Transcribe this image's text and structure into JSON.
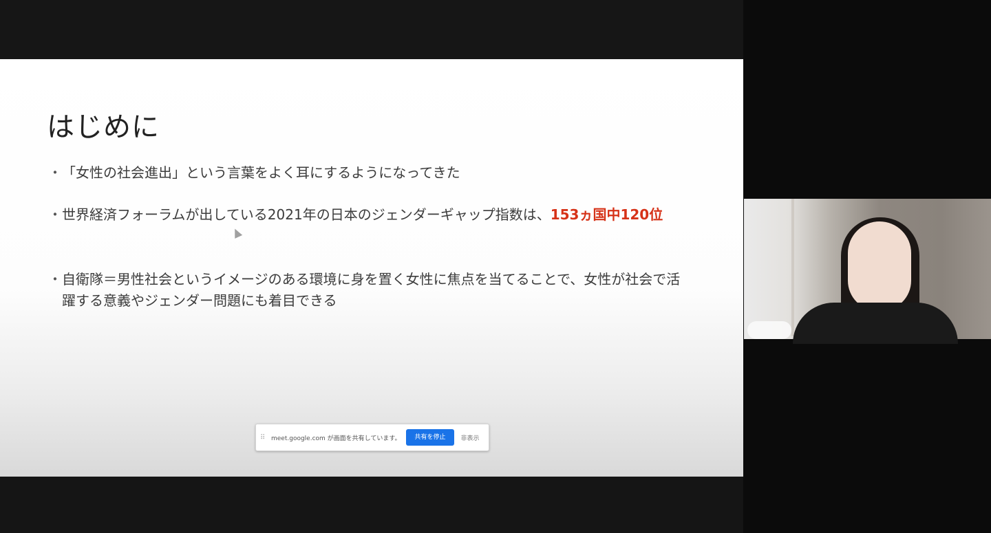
{
  "slide": {
    "title": "はじめに",
    "bullet_marker": "・",
    "bullets": [
      {
        "text": "「女性の社会進出」という言葉をよく耳にするようになってきた",
        "highlight": ""
      },
      {
        "text": "世界経済フォーラムが出している2021年の日本のジェンダーギャップ指数は、",
        "highlight": "153ヵ国中120位"
      },
      {
        "text": "自衛隊＝男性社会というイメージのある環境に身を置く女性に焦点を当てることで、女性が社会で活躍する意義やジェンダー問題にも着目できる",
        "highlight": ""
      }
    ],
    "highlight_color": "#d63218"
  },
  "share_bar": {
    "message": "meet.google.com が画面を共有しています。",
    "stop_button": "共有を停止",
    "hide_button": "非表示"
  }
}
